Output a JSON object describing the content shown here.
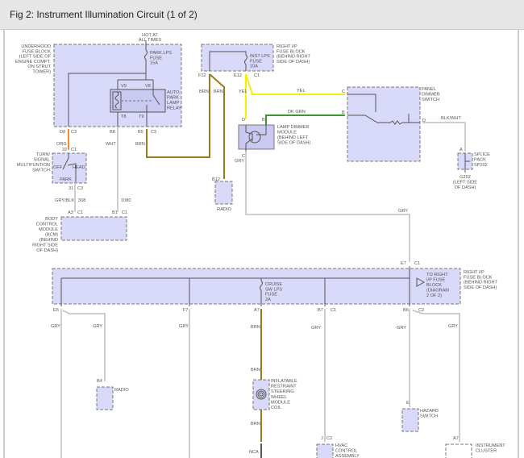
{
  "header": {
    "title": "Fig 2: Instrument Illumination Circuit (1 of 2)"
  },
  "labels": {
    "hot_at_all_times": [
      "HOT AT",
      "ALL TIMES"
    ],
    "underhood_fuse_block": [
      "UNDERHOOD",
      "FUSE BLOCK",
      "(LEFT SIDE OF",
      "ENGINE COMPT.",
      "ON STRUT",
      "TOWER)"
    ],
    "park_lps_fuse": [
      "PARK LPS",
      "FUSE",
      "15A"
    ],
    "auto_park_lamp_relay": [
      "AUTO",
      "PARK",
      "LAMP",
      "RELAY"
    ],
    "relay_pins": {
      "v9": "V9",
      "v8": "V8",
      "t8": "T8",
      "t9": "T9"
    },
    "underhood_connectors": {
      "d8": "D8",
      "c3a": "C3",
      "b8": "B8",
      "b5": "B5",
      "c3b": "C3"
    },
    "wire_org": "ORG",
    "wire_wht": "WHT",
    "wire_brn1": "BRN",
    "turn_signal_connectors": {
      "p32": "32",
      "c1": "C1",
      "p31": "31",
      "c3": "C3"
    },
    "turn_signal_switch": [
      "TURN/",
      "SIGNAL",
      "MULTIFUNTION",
      "SWITCH"
    ],
    "switch_positions": {
      "off": "OFF",
      "head": "HEAD",
      "park": "PARK"
    },
    "wire_grybl": "GRY/BLK",
    "circuit_308": "308",
    "circuit_1080": "1080",
    "bcm_connectors": {
      "a3": "A3",
      "c1a": "C1",
      "b1": "B1",
      "c1b": "C1"
    },
    "bcm": [
      "BODY",
      "CONTROL",
      "MODULE",
      "(BCM)",
      "(BEHIND",
      "RIGHT SIDE",
      "OF DASH)"
    ],
    "right_ip_fuse_block_top": [
      "RIGHT I/P",
      "FUSE BLOCK",
      "(BEHIND RIGHT",
      "SIDE OF DASH)"
    ],
    "inst_lps_fuse": [
      "INST LPS",
      "FUSE",
      "10A"
    ],
    "ip_connectors": {
      "f12": "F12",
      "e12": "E12",
      "c1": "C1"
    },
    "wire_brn2": "BRN",
    "wire_brn3": "BRN",
    "wire_yel1": "YEL",
    "wire_yel2": "YEL",
    "wire_dkgrn": "DK GRN",
    "radio_top": {
      "pin": "B12",
      "name": "RADIO"
    },
    "lamp_dimmer_pins": {
      "d": "D",
      "b": "B",
      "c": "C"
    },
    "wire_gry_c": "GRY",
    "lamp_dimmer_module": [
      "LAMP DIMMER",
      "MODULE",
      "(BEHIND LEFT",
      "SIDE OF DASH)"
    ],
    "panel_dimmer_switch": [
      "PANEL",
      "DIMMER",
      "SWITCH"
    ],
    "panel_pins": {
      "c": "C",
      "b": "B",
      "d": "D"
    },
    "wire_blkwht": "BLK/WHT",
    "splice_pin": "A",
    "splice_pack": [
      "SPLICE",
      "PACK",
      "SP202"
    ],
    "ground": [
      "G202",
      "(LEFT SIDE",
      "OF DASH)"
    ],
    "wire_gry_run": "GRY",
    "e7c1": {
      "e7": "E7",
      "c1": "C1"
    },
    "right_ip_fuse_block_bottom": [
      "RIGHT I/P",
      "FUSE BLOCK",
      "(BEHIND RIGHT",
      "SIDE OF DASH)"
    ],
    "cruise_fuse": [
      "CRUISE",
      "SW LPS",
      "FUSE",
      "2A"
    ],
    "to_right_ip": [
      "TO RIGHT",
      "I/P FUSE",
      "BLOCK",
      "(DIAGRAM",
      "2 OF 2)"
    ],
    "bottom_connectors": {
      "e6": "E6",
      "f7": "F7",
      "a7": "A7",
      "b7": "B7",
      "c1": "C1",
      "b6": "B6",
      "c2": "C2"
    },
    "bottom_wires": {
      "gry1": "GRY",
      "gry2": "GRY",
      "gry3": "GRY",
      "brn": "BRN",
      "gry4": "GRY",
      "gry5": "GRY",
      "gry6": "GRY",
      "brn2": "BRN",
      "brn3": "BRN",
      "nca": "NCA"
    },
    "radio_bottom": {
      "pin": "B4",
      "name": "RADIO"
    },
    "restraint_coil": [
      "INFLATABLE",
      "RESTRAINT",
      "STEERING",
      "WHEEL",
      "MODULE",
      "COIL"
    ],
    "hvac_pins": {
      "j": "J",
      "c2": "C2"
    },
    "hvac": [
      "HVAC",
      "CONTROL",
      "ASSEMBLY"
    ],
    "hazard_pin": "E",
    "hazard_switch": [
      "HAZARD",
      "SWITCH"
    ],
    "cluster_pin": "A7",
    "instrument_cluster": [
      "INSTRUMENT",
      "CLUSTER"
    ]
  }
}
